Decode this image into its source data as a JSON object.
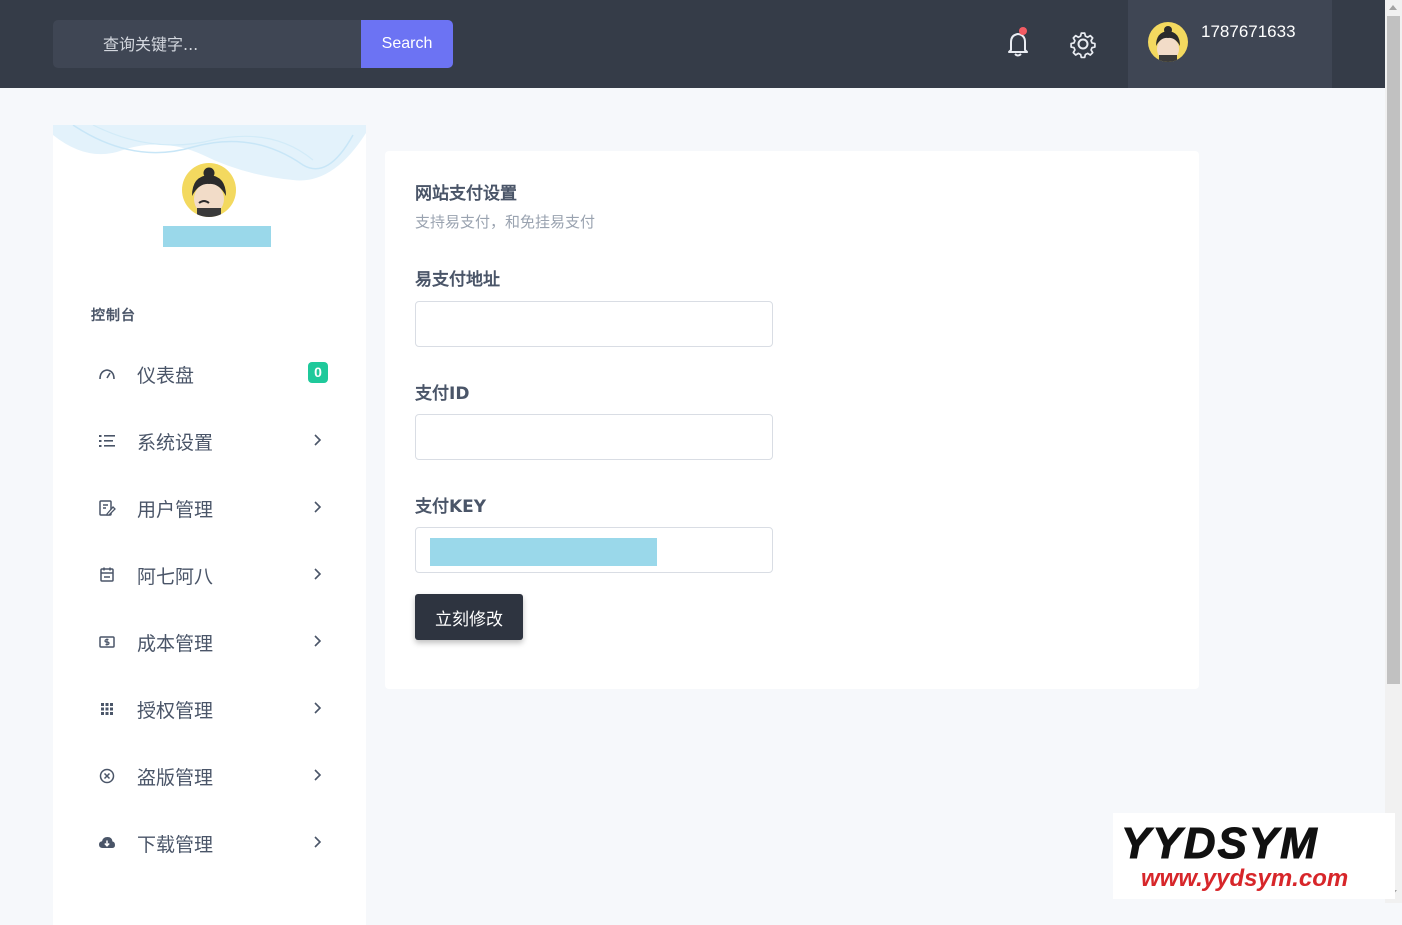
{
  "header": {
    "search_placeholder": "查询关键字...",
    "search_button": "Search",
    "username": "1787671633",
    "icons": [
      "bell-icon",
      "gear-icon"
    ],
    "notification_dot_color": "#f25b63",
    "accent_color": "#6c73f3"
  },
  "sidebar": {
    "section_title": "控制台",
    "items": [
      {
        "label": "仪表盘",
        "icon": "dashboard-gauge-icon",
        "badge": "0"
      },
      {
        "label": "系统设置",
        "icon": "list-icon"
      },
      {
        "label": "用户管理",
        "icon": "edit-user-icon"
      },
      {
        "label": "阿七阿八",
        "icon": "calendar-icon"
      },
      {
        "label": "成本管理",
        "icon": "money-icon"
      },
      {
        "label": "授权管理",
        "icon": "grid-icon"
      },
      {
        "label": "盗版管理",
        "icon": "close-circle-icon"
      },
      {
        "label": "下载管理",
        "icon": "cloud-download-icon"
      }
    ],
    "badge_color": "#1fc99b"
  },
  "main": {
    "title": "网站支付设置",
    "subtitle": "支持易支付，和免挂易支付",
    "fields": [
      {
        "label": "易支付地址",
        "value": ""
      },
      {
        "label": "支付ID",
        "value": ""
      },
      {
        "label": "支付KEY",
        "value": ""
      }
    ],
    "submit_label": "立刻修改"
  },
  "watermark": {
    "title": "YYDSYM",
    "url": "www.yydsym.com"
  }
}
